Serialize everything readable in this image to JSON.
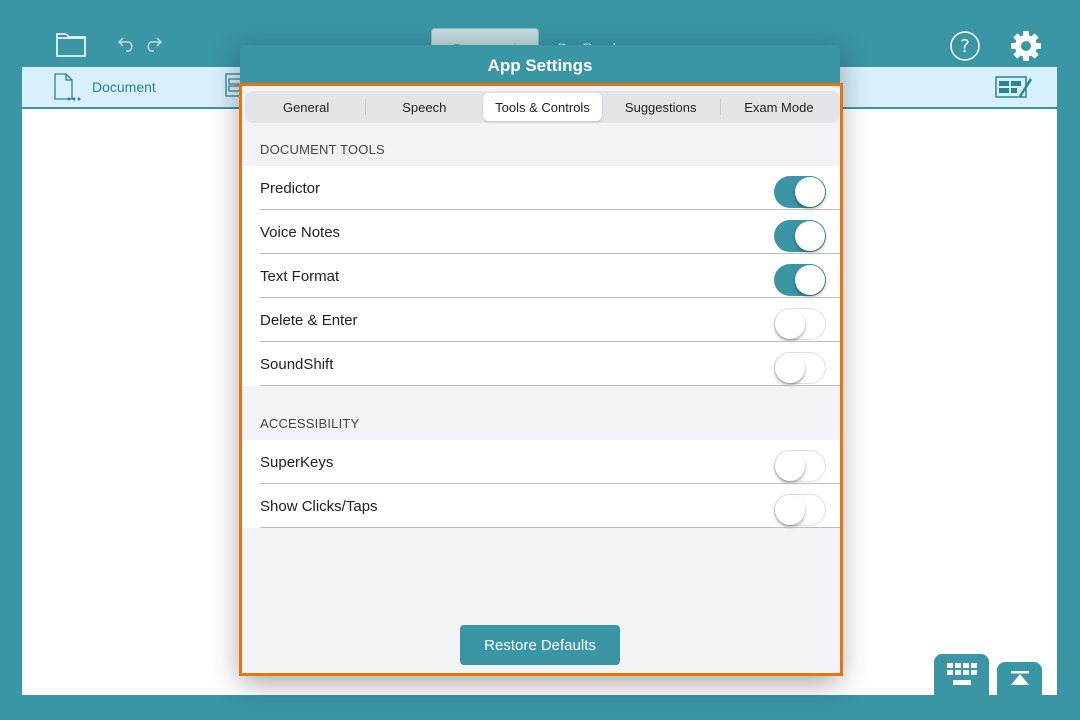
{
  "topbar": {
    "icons": [
      "folder-icon",
      "undo-icon",
      "redo-icon",
      "help-icon",
      "gear-icon"
    ],
    "background_tabs": [
      {
        "label": "Document",
        "active": true
      },
      {
        "label": "DocReader",
        "active": false
      }
    ]
  },
  "doc_toolbar": {
    "document_label": "Document",
    "icons": [
      "document-icon",
      "layout-icon",
      "edit-grid-icon"
    ]
  },
  "modal": {
    "title": "App Settings",
    "tabs": [
      {
        "label": "General",
        "selected": false
      },
      {
        "label": "Speech",
        "selected": false
      },
      {
        "label": "Tools & Controls",
        "selected": true
      },
      {
        "label": "Suggestions",
        "selected": false
      },
      {
        "label": "Exam Mode",
        "selected": false
      }
    ],
    "sections": [
      {
        "title": "DOCUMENT TOOLS",
        "items": [
          {
            "label": "Predictor",
            "enabled": true
          },
          {
            "label": "Voice Notes",
            "enabled": true
          },
          {
            "label": "Text Format",
            "enabled": true
          },
          {
            "label": "Delete & Enter",
            "enabled": false
          },
          {
            "label": "SoundShift",
            "enabled": false
          }
        ]
      },
      {
        "title": "ACCESSIBILITY",
        "items": [
          {
            "label": "SuperKeys",
            "enabled": false
          },
          {
            "label": "Show Clicks/Taps",
            "enabled": false
          }
        ]
      }
    ],
    "restore_label": "Restore Defaults"
  },
  "bottom": {
    "icons": [
      "keyboard-icon",
      "scroll-to-top-icon"
    ]
  },
  "colors": {
    "brand": "#3a95a5",
    "highlight_border": "#e8740f",
    "toolbar_bg": "#d8f0fb"
  }
}
